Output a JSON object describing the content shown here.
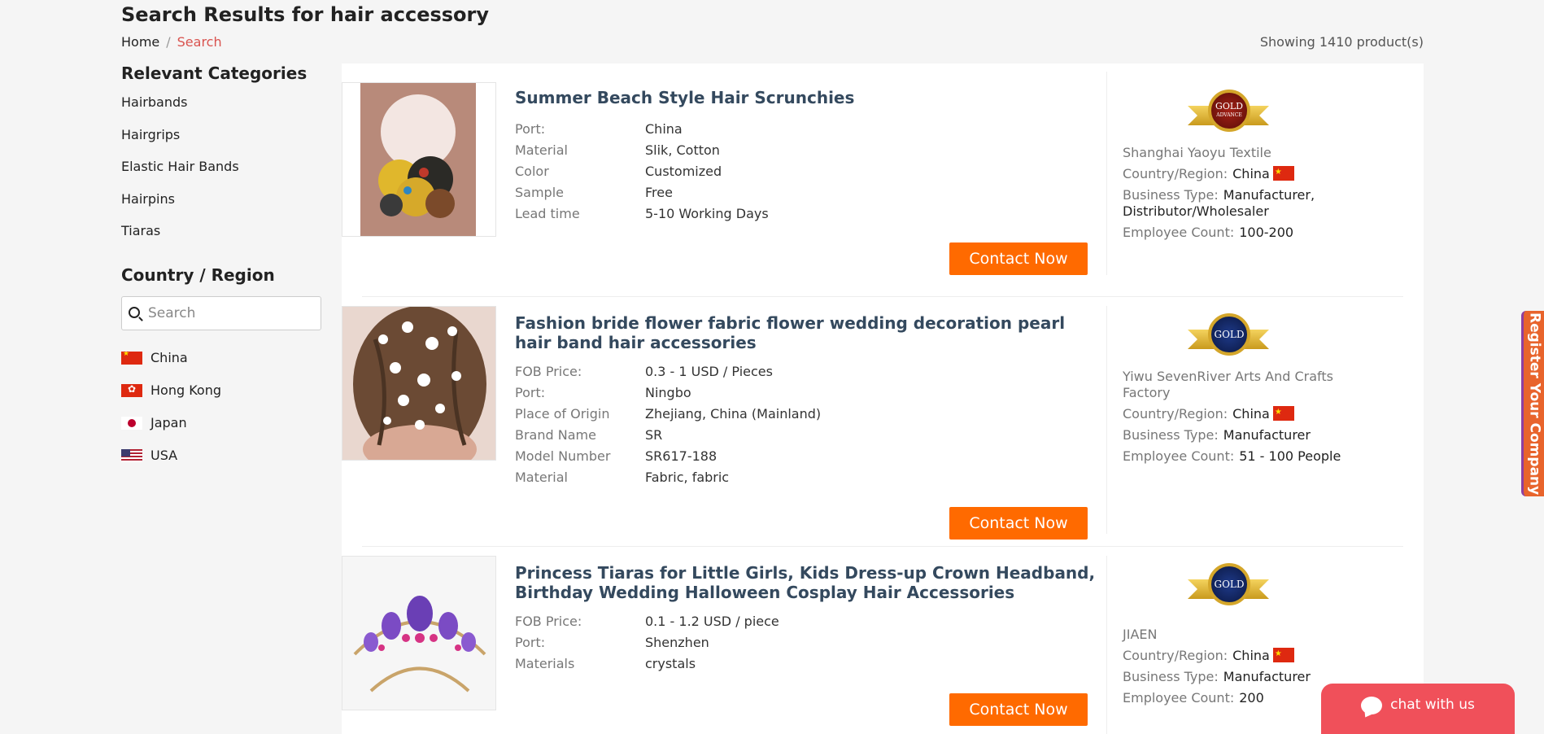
{
  "header": {
    "title": "Search Results for hair accessory",
    "breadcrumb": {
      "home": "Home",
      "separator": "/",
      "current": "Search"
    },
    "showing": "Showing 1410 product(s)"
  },
  "sidebar": {
    "categories_heading": "Relevant Categories",
    "categories": [
      "Hairbands",
      "Hairgrips",
      "Elastic Hair Bands",
      "Hairpins",
      "Tiaras"
    ],
    "country_heading": "Country / Region",
    "country_search_placeholder": "Search",
    "countries": [
      "China",
      "Hong Kong",
      "Japan",
      "USA"
    ]
  },
  "products": [
    {
      "title": "Summer Beach Style Hair Scrunchies",
      "attributes": [
        {
          "key": "Port:",
          "value": "China"
        },
        {
          "key": "Material",
          "value": "Slik, Cotton"
        },
        {
          "key": "Color",
          "value": "Customized"
        },
        {
          "key": "Sample",
          "value": "Free"
        },
        {
          "key": "Lead time",
          "value": "5-10 Working Days"
        }
      ],
      "button": "Contact Now",
      "supplier": {
        "badge": "GOLD",
        "badge_sub": "ADVANCE",
        "name": "Shanghai Yaoyu Textile",
        "country_label": "Country/Region:",
        "country": "China",
        "business_label": "Business Type:",
        "business": "Manufacturer, Distributor/Wholesaler",
        "employee_label": "Employee Count:",
        "employee": "100-200"
      }
    },
    {
      "title": "Fashion bride flower fabric flower wedding decoration pearl hair band hair accessories",
      "attributes": [
        {
          "key": "FOB Price:",
          "value": "0.3 - 1 USD / Pieces"
        },
        {
          "key": "Port:",
          "value": "Ningbo"
        },
        {
          "key": "Place of Origin",
          "value": "Zhejiang, China (Mainland)"
        },
        {
          "key": "Brand Name",
          "value": "SR"
        },
        {
          "key": "Model Number",
          "value": "SR617-188"
        },
        {
          "key": "Material",
          "value": "Fabric, fabric"
        }
      ],
      "button": "Contact Now",
      "supplier": {
        "badge": "GOLD",
        "name": "Yiwu SevenRiver Arts And Crafts Factory",
        "country_label": "Country/Region:",
        "country": "China",
        "business_label": "Business Type:",
        "business": "Manufacturer",
        "employee_label": "Employee Count:",
        "employee": "51 - 100 People"
      }
    },
    {
      "title": "Princess Tiaras for Little Girls, Kids Dress-up Crown Headband, Birthday Wedding Halloween Cosplay Hair Accessories",
      "attributes": [
        {
          "key": "FOB Price:",
          "value": "0.1 - 1.2 USD / piece"
        },
        {
          "key": "Port:",
          "value": "Shenzhen"
        },
        {
          "key": "Materials",
          "value": "crystals"
        }
      ],
      "button": "Contact Now",
      "supplier": {
        "badge": "GOLD",
        "name": "JIAEN",
        "country_label": "Country/Region:",
        "country": "China",
        "business_label": "Business Type:",
        "business": "Manufacturer",
        "employee_label": "Employee Count:",
        "employee": "200"
      }
    }
  ],
  "widgets": {
    "register_tab": "Register Your Company",
    "chat": "chat with us"
  },
  "colors": {
    "accent_orange": "#ff6a00",
    "breadcrumb_active": "#d9534f",
    "chat_bg": "#f0505a",
    "title_color": "#34495e"
  }
}
